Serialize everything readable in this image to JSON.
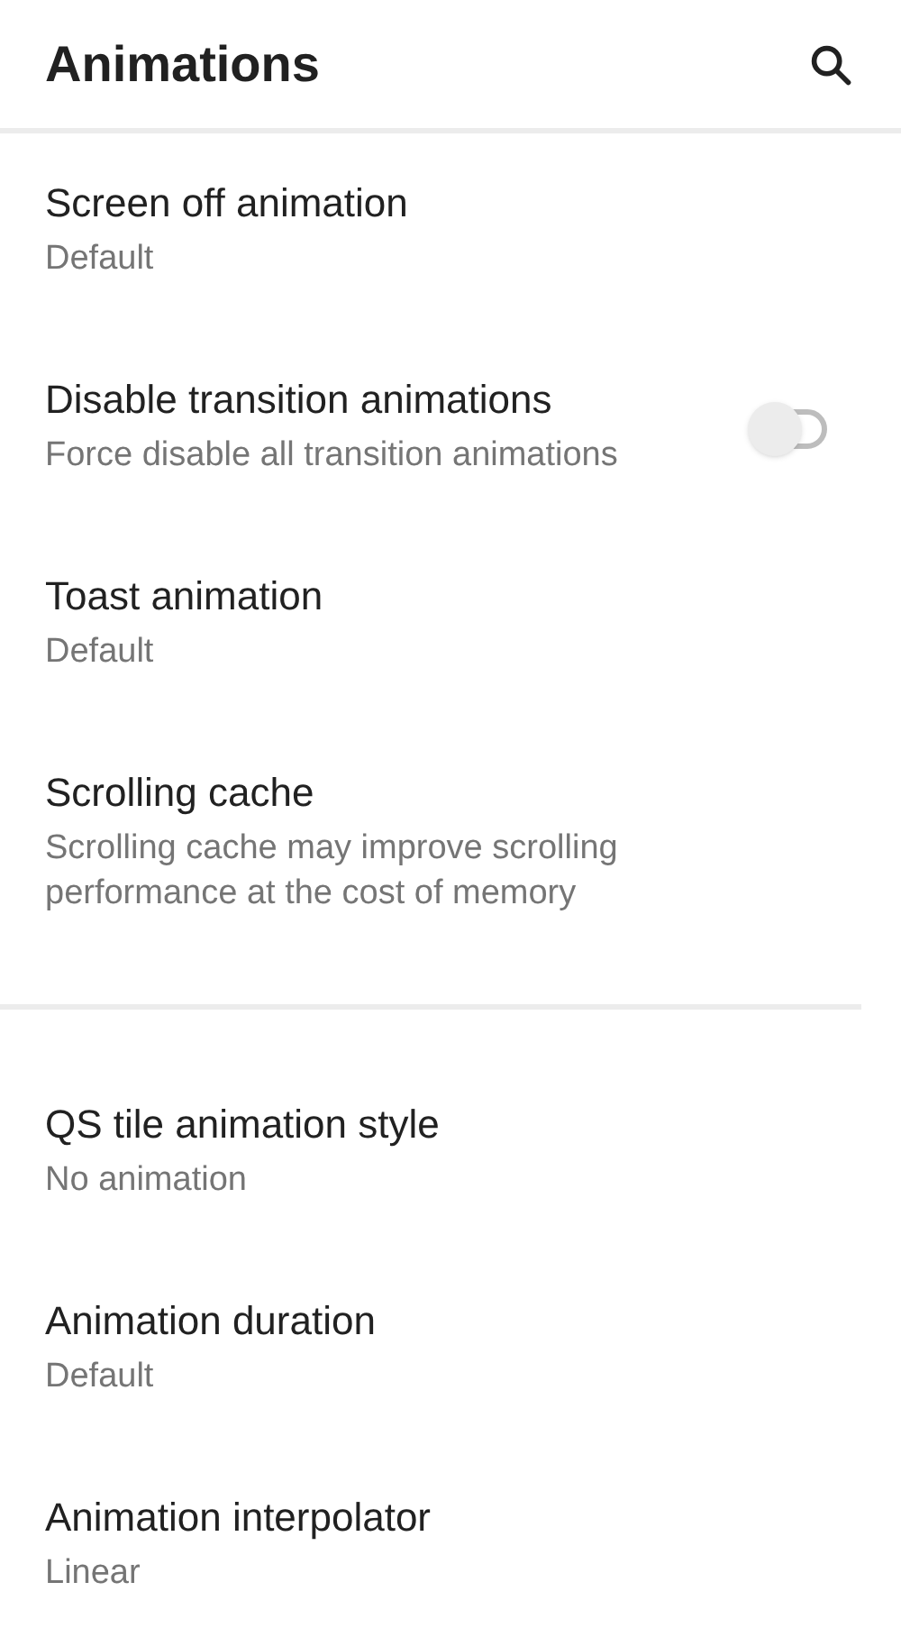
{
  "app_bar": {
    "title": "Animations"
  },
  "sections": [
    {
      "items": [
        {
          "kind": "text",
          "title": "Screen off animation",
          "summary": "Default"
        },
        {
          "kind": "switch",
          "title": "Disable transition animations",
          "summary": "Force disable all transition animations",
          "on": false
        },
        {
          "kind": "text",
          "title": "Toast animation",
          "summary": "Default"
        },
        {
          "kind": "text",
          "title": "Scrolling cache",
          "summary": "Scrolling cache may improve scrolling performance at the cost of memory"
        }
      ]
    },
    {
      "items": [
        {
          "kind": "text",
          "title": "QS tile animation style",
          "summary": "No animation"
        },
        {
          "kind": "text",
          "title": "Animation duration",
          "summary": "Default"
        },
        {
          "kind": "text",
          "title": "Animation interpolator",
          "summary": "Linear"
        }
      ]
    }
  ]
}
